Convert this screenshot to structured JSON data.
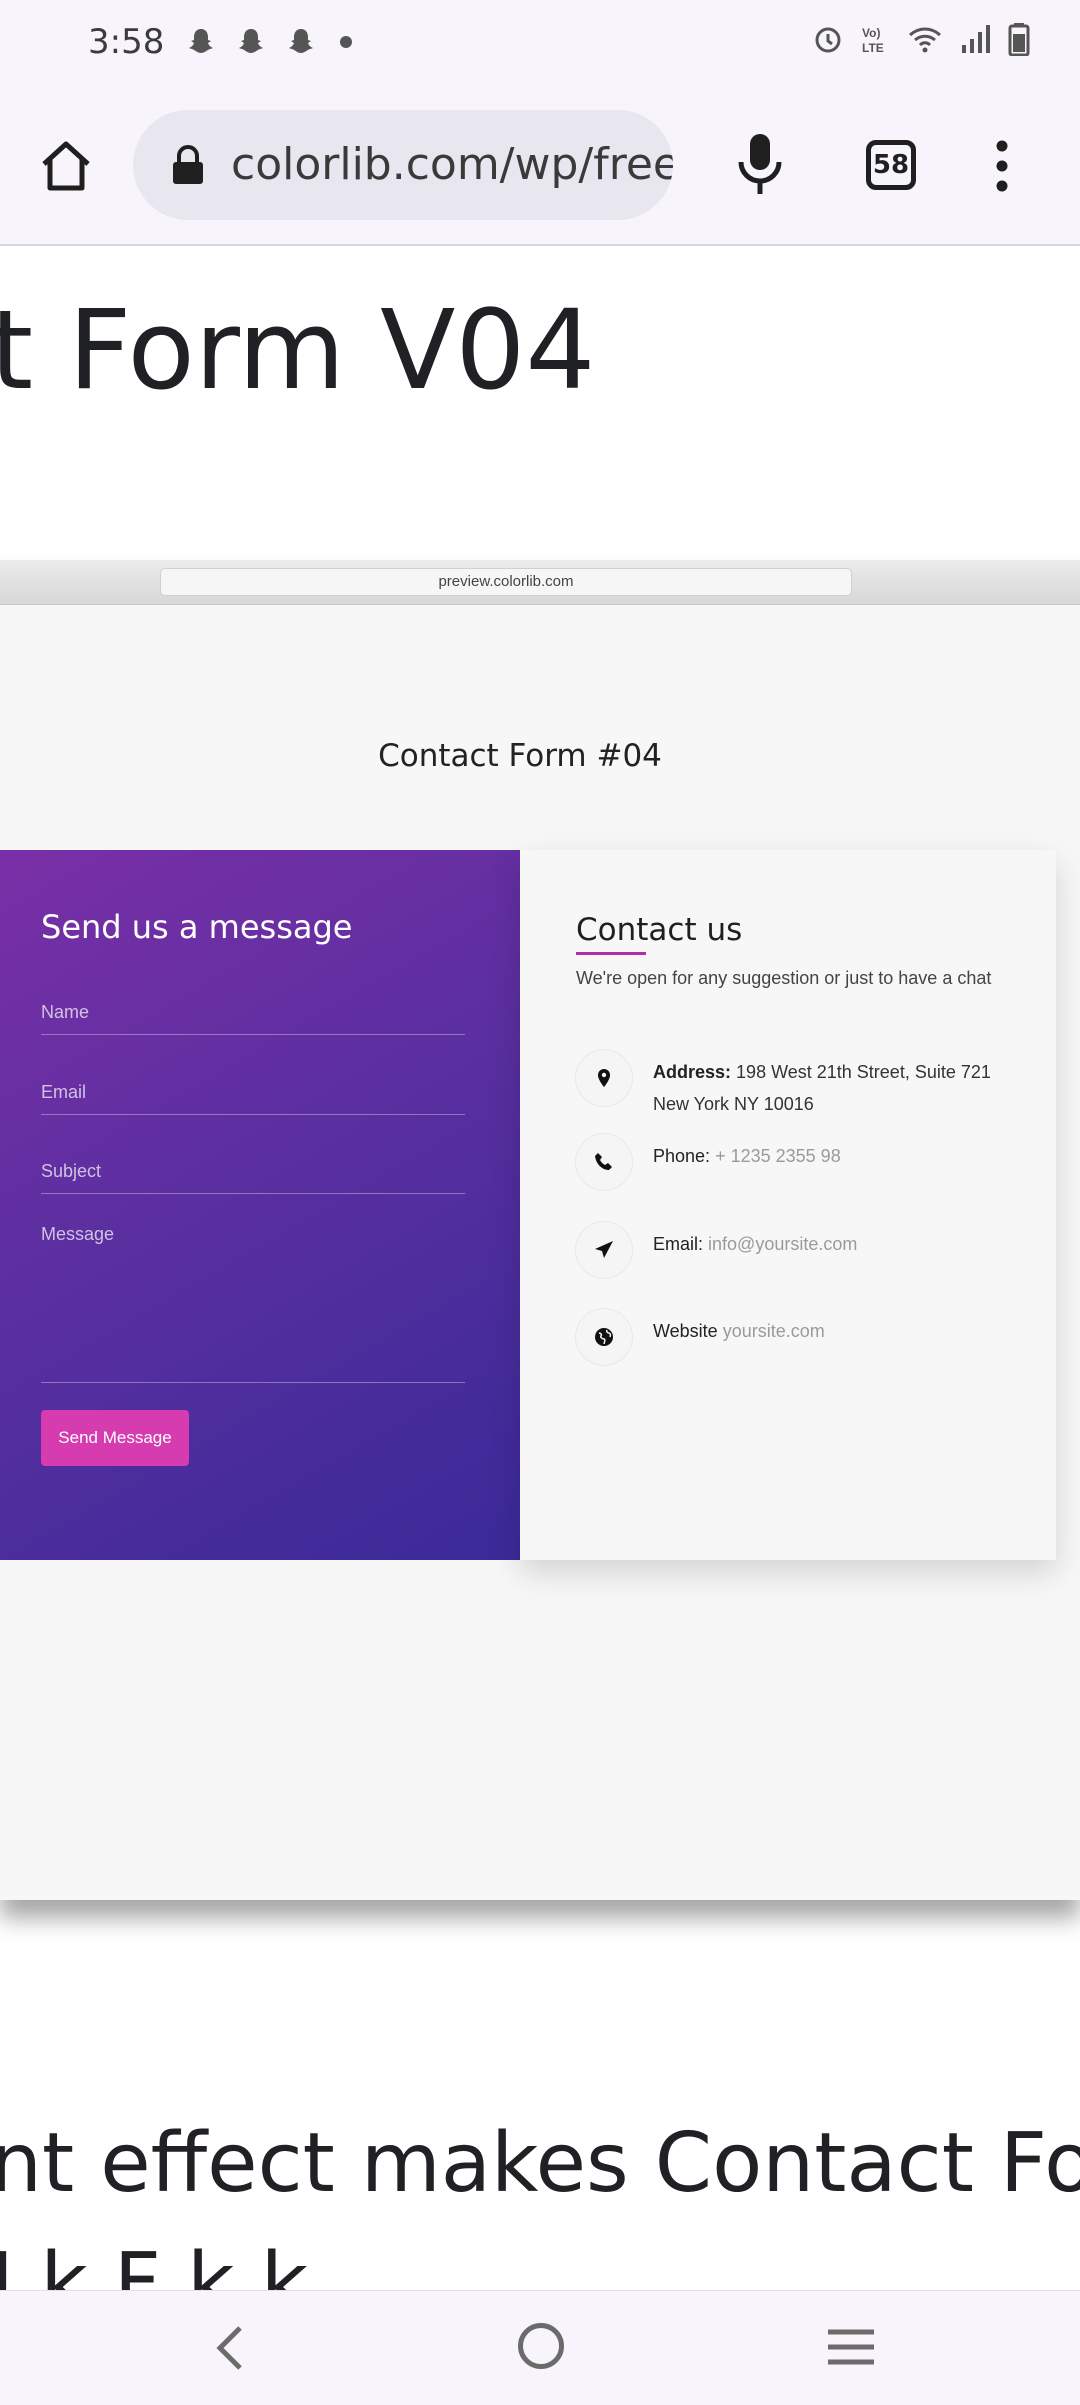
{
  "status_bar": {
    "time": "3:58",
    "notifications": [
      "snapchat-icon",
      "snapchat-icon",
      "snapchat-icon",
      "dot-icon"
    ],
    "right_icons": [
      "alarm-icon",
      "volte-icon",
      "wifi-icon",
      "signal-icon",
      "battery-icon"
    ]
  },
  "browser": {
    "url": "colorlib.com/wp/free-",
    "tab_count": "58"
  },
  "page": {
    "heading": "t Form V04",
    "lower_text": "nt effect makes Contact Form",
    "lower_text2": "I  k                       F           k          k"
  },
  "preview": {
    "mac_url": "preview.colorlib.com",
    "title": "Contact Form #04",
    "form": {
      "title": "Send us a message",
      "name_placeholder": "Name",
      "email_placeholder": "Email",
      "subject_placeholder": "Subject",
      "message_placeholder": "Message",
      "button": "Send Message"
    },
    "contact": {
      "title": "Contact us",
      "description": "We're open for any suggestion or just to have a chat",
      "address_label": "Address:",
      "address_value": "198 West 21th Street, Suite 721 New York NY 10016",
      "phone_label": "Phone:",
      "phone_value": "+ 1235 2355 98",
      "email_label": "Email:",
      "email_value": "info@yoursite.com",
      "website_label": "Website",
      "website_value": "yoursite.com"
    }
  },
  "colors": {
    "gradient_start": "#7a2fa7",
    "gradient_end": "#3a2a98",
    "button": "#d63bb0",
    "underline": "#b02fa8"
  }
}
